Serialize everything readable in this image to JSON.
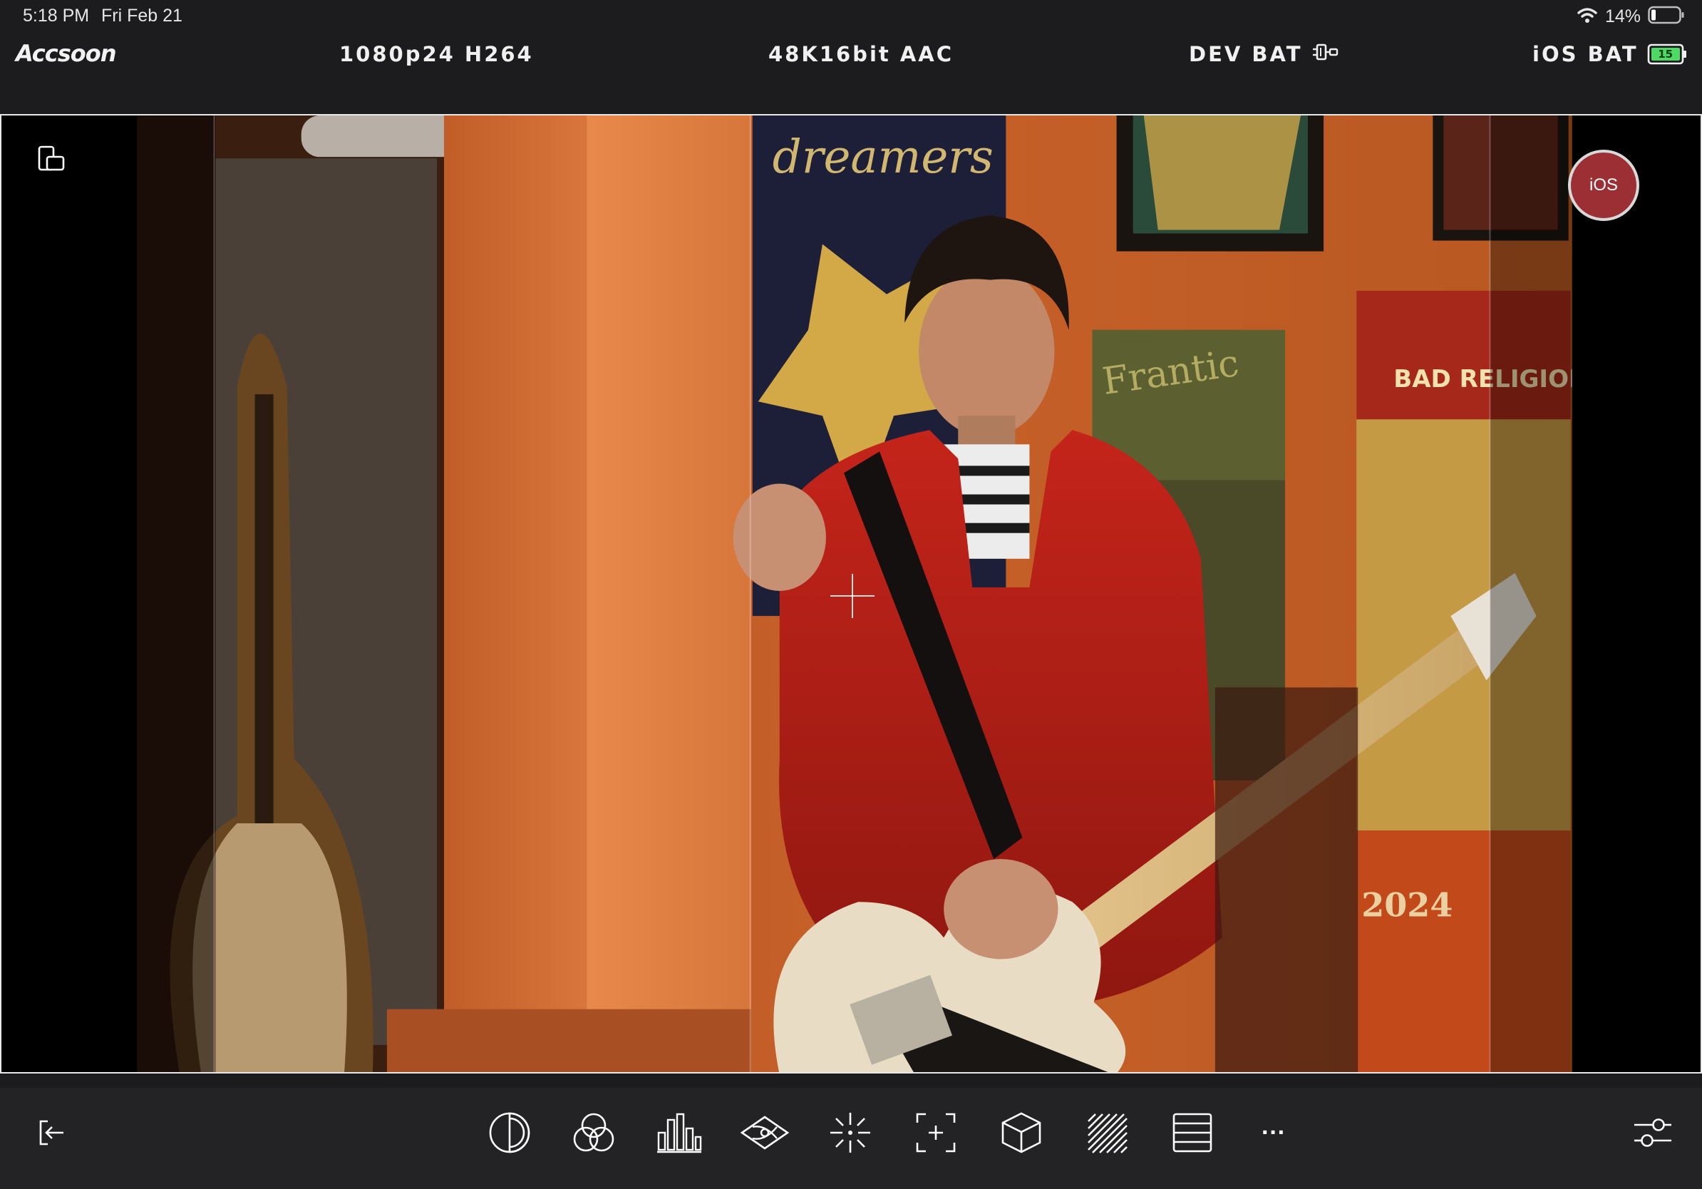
{
  "status_bar": {
    "time": "5:18 PM",
    "date": "Fri Feb 21",
    "battery_percent": "14%",
    "icons": [
      "wifi-icon",
      "device-battery-icon"
    ]
  },
  "header": {
    "logo": "Accsoon",
    "video_format": "1080p24 H264",
    "audio_format": "48K16bit AAC",
    "dev_bat_label": "DEV BAT",
    "dev_bat_icon": "plug-battery-icon",
    "ios_bat_label": "iOS BAT",
    "ios_bat_value": "15",
    "ios_bat_color": "#4cd964"
  },
  "viewer": {
    "ios_button_label": "iOS",
    "record_color": "#9b2f33",
    "rotate_icon": "rotate-device-icon",
    "crosshair_icon": "center-crosshair-icon"
  },
  "toolbar": {
    "exit_icon": "exit-icon",
    "tools": [
      {
        "name": "false-color",
        "icon": "contrast-circle-icon"
      },
      {
        "name": "rgb-parade",
        "icon": "color-circles-icon"
      },
      {
        "name": "histogram",
        "icon": "histogram-icon"
      },
      {
        "name": "vectorscope",
        "icon": "vectorscope-icon"
      },
      {
        "name": "focus-peaking",
        "icon": "focus-peaking-icon"
      },
      {
        "name": "frame-guide",
        "icon": "frame-guide-icon"
      },
      {
        "name": "lut-3d",
        "icon": "cube-icon"
      },
      {
        "name": "zebra",
        "icon": "zebra-stripes-icon"
      },
      {
        "name": "waveform",
        "icon": "waveform-lines-icon"
      }
    ],
    "more_label": "···",
    "settings_icon": "sliders-icon"
  }
}
